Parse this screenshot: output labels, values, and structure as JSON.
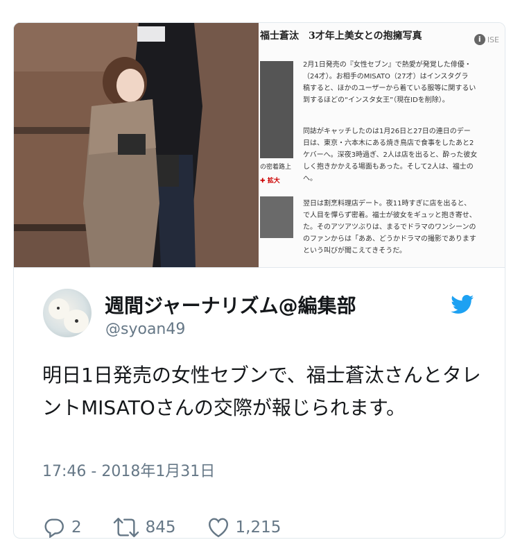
{
  "media": {
    "clip": {
      "title": "福士蒼汰　3才年上美女との抱擁写真",
      "info_label": "ISE",
      "paragraphs": [
        "2月1日発売の『女性セブン』で熱愛が発覚した俳優・\n（24才）。お相手のMISATO（27才）はインスタグラ\n稿すると、ほかのユーザーから着ている服等に関するい\n到するほどの“インスタ女王”（現在IDを削除）。",
        "同誌がキャッチしたのは1月26日と27日の連日のデー\n日は、東京・六本木にある焼き鳥店で食事をしたあと2\nケバーへ。深夜3時過ぎ、2人は店を出ると、酔った彼女\nしく抱きかかえる場面もあった。そして2人は、福士の\nへ。",
        "翌日は割烹料理店デート。夜11時すぎに店を出ると、\nで人目を憚らず密着。福士が彼女をギュッと抱き寄せ、\nた。そのアツアツぶりは、まるでドラマのワンシーンの\nのファンからは「ああ、どうかドラマの撮影であります\nという叫びが聞こえてきそうだ。"
      ],
      "thumb_caption": "の密着路上",
      "zoom_label": "拡大"
    }
  },
  "tweet": {
    "display_name": "週間ジャーナリズム@編集部",
    "handle": "@syoan49",
    "text": "明日1日発売の女性セブンで、福士蒼汰さんとタレントMISATOさんの交際が報じられます。",
    "timestamp": "17:46 - 2018年1月31日",
    "actions": {
      "replies": "2",
      "retweets": "845",
      "likes": "1,215"
    }
  },
  "colors": {
    "twitter_blue": "#1da1f2",
    "secondary_text": "#657786",
    "primary_text": "#14171a",
    "border": "#e1e8ed"
  }
}
